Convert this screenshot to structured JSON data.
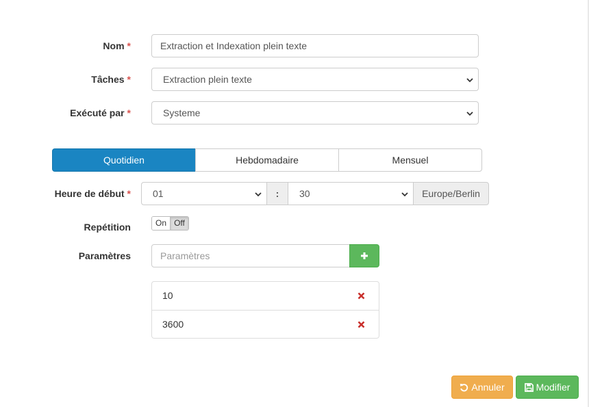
{
  "form": {
    "nom": {
      "label": "Nom",
      "required_mark": "*",
      "value": "Extraction et Indexation plein texte"
    },
    "taches": {
      "label": "Tâches",
      "required_mark": "*",
      "value": "Extraction plein texte"
    },
    "execute_par": {
      "label": "Exécuté par",
      "required_mark": "*",
      "value": "Systeme"
    },
    "frequency_tabs": [
      {
        "label": "Quotidien",
        "active": true
      },
      {
        "label": "Hebdomadaire",
        "active": false
      },
      {
        "label": "Mensuel",
        "active": false
      }
    ],
    "heure_debut": {
      "label": "Heure de début",
      "required_mark": "*",
      "hour": "01",
      "separator": ":",
      "minute": "30",
      "timezone": "Europe/Berlin"
    },
    "repetition": {
      "label": "Repétition",
      "on_label": "On",
      "off_label": "Off",
      "state": "Off"
    },
    "parametres": {
      "label": "Paramètres",
      "placeholder": "Paramètres",
      "items": [
        "10",
        "3600"
      ]
    }
  },
  "footer": {
    "cancel_label": "Annuler",
    "save_label": "Modifier"
  },
  "colors": {
    "primary": "#1a85c2",
    "success": "#5cb85c",
    "warning": "#f0ad4e",
    "danger": "#d9534f",
    "required": "#d9534f"
  },
  "icons": {
    "add": "plus-icon",
    "remove": "remove-icon",
    "cancel": "undo-icon",
    "save": "floppy-icon",
    "select": "chevron-down-icon"
  }
}
